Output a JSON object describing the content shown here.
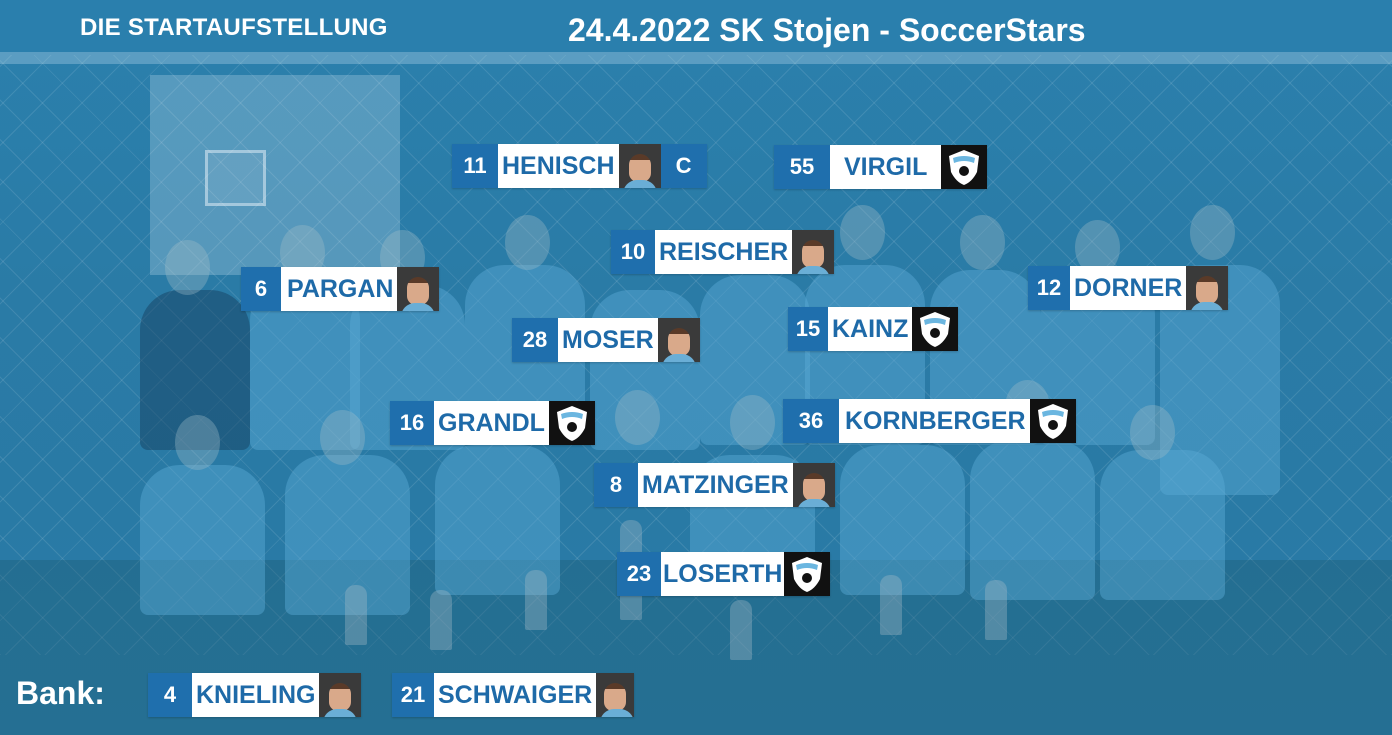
{
  "header": {
    "left_title": "DIE STARTAUFSTELLUNG",
    "match_title": "24.4.2022 SK Stojen - SoccerStars"
  },
  "bench_label": "Bank:",
  "players": [
    {
      "number": "11",
      "name": "HENISCH",
      "badge": "photo",
      "extra": "C"
    },
    {
      "number": "55",
      "name": "VIRGIL",
      "badge": "club-logo"
    },
    {
      "number": "10",
      "name": "REISCHER",
      "badge": "photo"
    },
    {
      "number": "6",
      "name": "PARGAN",
      "badge": "photo"
    },
    {
      "number": "12",
      "name": "DORNER",
      "badge": "photo"
    },
    {
      "number": "28",
      "name": "MOSER",
      "badge": "photo"
    },
    {
      "number": "15",
      "name": "KAINZ",
      "badge": "club-logo"
    },
    {
      "number": "16",
      "name": "GRANDL",
      "badge": "club-logo"
    },
    {
      "number": "36",
      "name": "KORNBERGER",
      "badge": "club-logo"
    },
    {
      "number": "8",
      "name": "MATZINGER",
      "badge": "photo"
    },
    {
      "number": "23",
      "name": "LOSERTH",
      "badge": "club-logo"
    }
  ],
  "bench": [
    {
      "number": "4",
      "name": "KNIELING",
      "badge": "photo"
    },
    {
      "number": "21",
      "name": "SCHWAIGER",
      "badge": "photo"
    }
  ],
  "colors": {
    "number_box": "#1f6fad",
    "name_text": "#1e6aa8",
    "background": "#2a7aa6"
  }
}
